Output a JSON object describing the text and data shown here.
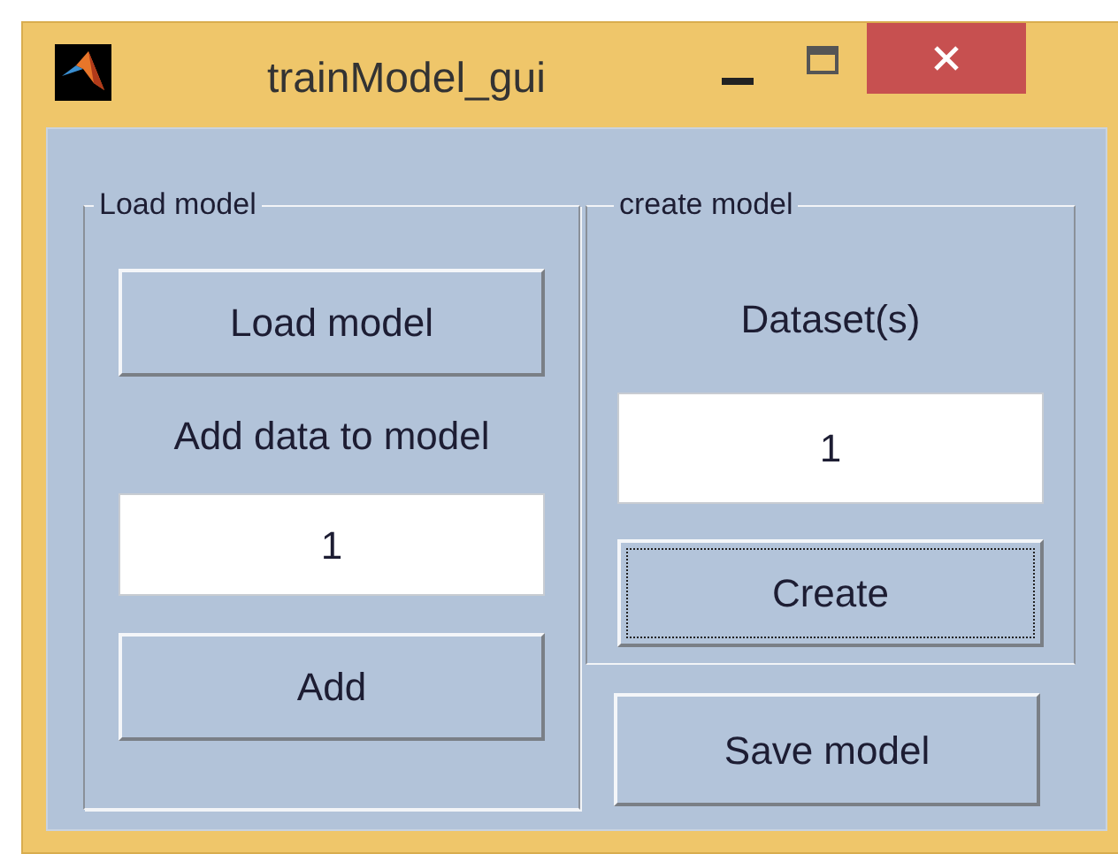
{
  "window": {
    "title": "trainModel_gui"
  },
  "panels": [
    {
      "title": "Load model",
      "items": [
        {
          "kind": "button",
          "label": "Load model",
          "focused": false
        },
        {
          "kind": "label",
          "text": "Add data to model"
        },
        {
          "kind": "field",
          "value": "1"
        },
        {
          "kind": "button",
          "label": "Add",
          "focused": false
        }
      ]
    },
    {
      "title": "create model",
      "items": [
        {
          "kind": "label",
          "text": "Dataset(s)"
        },
        {
          "kind": "field",
          "value": "1"
        },
        {
          "kind": "button",
          "label": "Create",
          "focused": true
        }
      ]
    }
  ],
  "save_button": {
    "label": "Save model",
    "focused": false
  }
}
